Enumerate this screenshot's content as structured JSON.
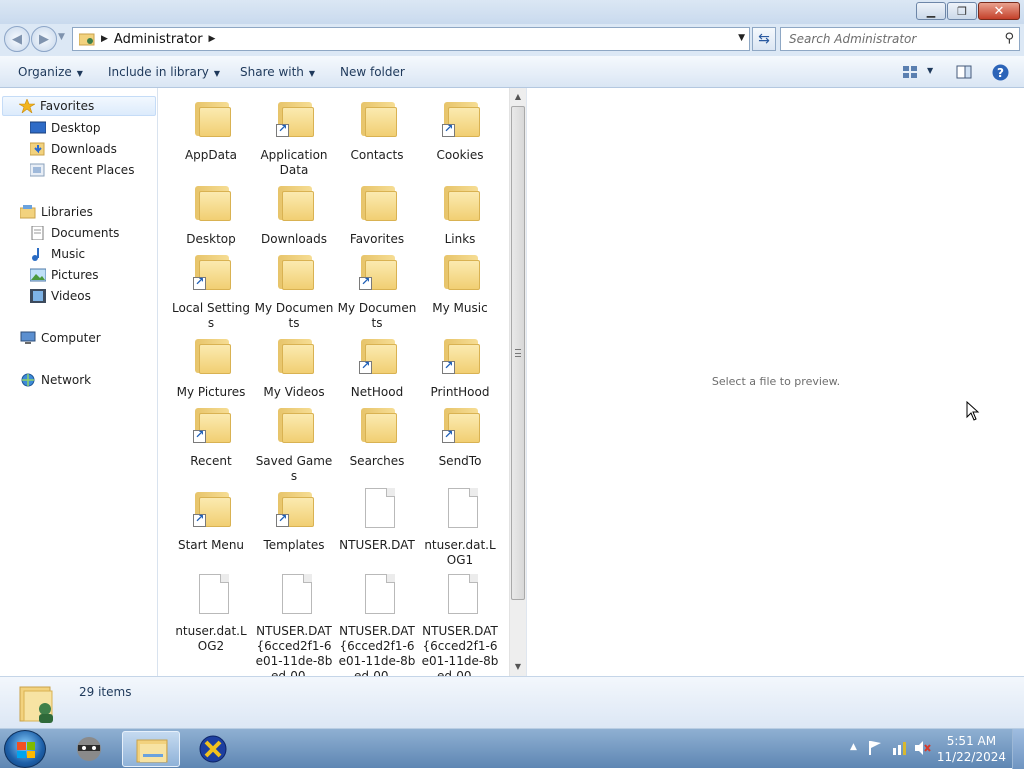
{
  "window": {
    "address": {
      "crumb": "Administrator"
    },
    "search": {
      "placeholder": "Search Administrator"
    }
  },
  "toolbar": {
    "organize": "Organize",
    "include_in_library": "Include in library",
    "share_with": "Share with",
    "new_folder": "New folder"
  },
  "navpane": {
    "favorites": "Favorites",
    "desktop": "Desktop",
    "downloads": "Downloads",
    "recent_places": "Recent Places",
    "libraries": "Libraries",
    "documents": "Documents",
    "music": "Music",
    "pictures": "Pictures",
    "videos": "Videos",
    "computer": "Computer",
    "network": "Network"
  },
  "files": [
    {
      "label": "AppData",
      "kind": "folder"
    },
    {
      "label": "Application Data",
      "kind": "folder-shortcut"
    },
    {
      "label": "Contacts",
      "kind": "folder"
    },
    {
      "label": "Cookies",
      "kind": "folder-shortcut"
    },
    {
      "label": "Desktop",
      "kind": "folder"
    },
    {
      "label": "Downloads",
      "kind": "folder"
    },
    {
      "label": "Favorites",
      "kind": "folder"
    },
    {
      "label": "Links",
      "kind": "folder"
    },
    {
      "label": "Local Settings",
      "kind": "folder-shortcut"
    },
    {
      "label": "My Documents",
      "kind": "folder"
    },
    {
      "label": "My Documents",
      "kind": "folder-shortcut"
    },
    {
      "label": "My Music",
      "kind": "folder"
    },
    {
      "label": "My Pictures",
      "kind": "folder"
    },
    {
      "label": "My Videos",
      "kind": "folder"
    },
    {
      "label": "NetHood",
      "kind": "folder-shortcut"
    },
    {
      "label": "PrintHood",
      "kind": "folder-shortcut"
    },
    {
      "label": "Recent",
      "kind": "folder-shortcut"
    },
    {
      "label": "Saved Games",
      "kind": "folder"
    },
    {
      "label": "Searches",
      "kind": "folder"
    },
    {
      "label": "SendTo",
      "kind": "folder-shortcut"
    },
    {
      "label": "Start Menu",
      "kind": "folder-shortcut"
    },
    {
      "label": "Templates",
      "kind": "folder-shortcut"
    },
    {
      "label": "NTUSER.DAT",
      "kind": "file"
    },
    {
      "label": "ntuser.dat.LOG1",
      "kind": "file"
    },
    {
      "label": "ntuser.dat.LOG2",
      "kind": "file"
    },
    {
      "label": "NTUSER.DAT{6cced2f1-6e01-11de-8bed-00...",
      "kind": "file"
    },
    {
      "label": "NTUSER.DAT{6cced2f1-6e01-11de-8bed-00...",
      "kind": "file"
    },
    {
      "label": "NTUSER.DAT{6cced2f1-6e01-11de-8bed-00...",
      "kind": "file"
    }
  ],
  "preview": {
    "message": "Select a file to preview."
  },
  "details": {
    "count": "29 items"
  },
  "taskbar": {
    "time": "5:51 AM",
    "date": "11/22/2024"
  }
}
